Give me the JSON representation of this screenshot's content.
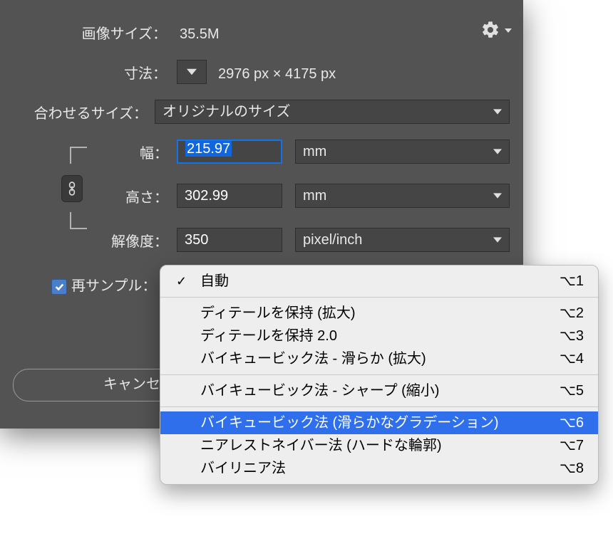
{
  "header": {
    "image_size_label": "画像サイズ：",
    "image_size_value": "35.5M",
    "gear_tip": "gear"
  },
  "dimensions": {
    "label": "寸法：",
    "value": "2976 px × 4175 px"
  },
  "fit": {
    "label": "合わせるサイズ：",
    "value": "オリジナルのサイズ"
  },
  "width": {
    "label": "幅：",
    "value": "215.97",
    "unit": "mm"
  },
  "height": {
    "label": "高さ：",
    "value": "302.99",
    "unit": "mm"
  },
  "resolution": {
    "label": "解像度：",
    "value": "350",
    "unit": "pixel/inch"
  },
  "resample": {
    "checkbox_checked": true,
    "label": "再サンプル："
  },
  "cancel_label": "キャンセ",
  "menu": {
    "items": [
      {
        "checked": true,
        "label": "自動",
        "shortcut": "⌥1"
      },
      null,
      {
        "checked": false,
        "label": "ディテールを保持 (拡大)",
        "shortcut": "⌥2"
      },
      {
        "checked": false,
        "label": "ディテールを保持 2.0",
        "shortcut": "⌥3"
      },
      {
        "checked": false,
        "label": "バイキュービック法 - 滑らか (拡大)",
        "shortcut": "⌥4"
      },
      null,
      {
        "checked": false,
        "label": "バイキュービック法 - シャープ (縮小)",
        "shortcut": "⌥5"
      },
      null,
      {
        "checked": false,
        "label": "バイキュービック法 (滑らかなグラデーション)",
        "shortcut": "⌥6",
        "highlight": true
      },
      {
        "checked": false,
        "label": "ニアレストネイバー法 (ハードな輪郭)",
        "shortcut": "⌥7"
      },
      {
        "checked": false,
        "label": "バイリニア法",
        "shortcut": "⌥8"
      }
    ]
  }
}
